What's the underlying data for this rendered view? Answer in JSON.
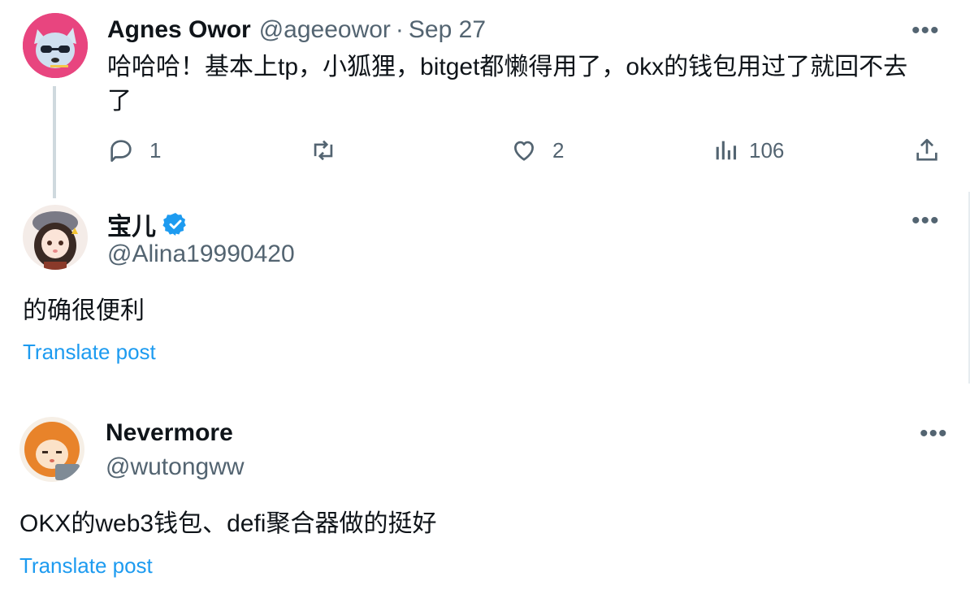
{
  "tweets": [
    {
      "name": "Agnes Owor",
      "handle": "@ageeowor",
      "separator": "·",
      "date": "Sep 27",
      "text": "哈哈哈！基本上tp，小狐狸，bitget都懒得用了，okx的钱包用过了就回不去了",
      "actions": {
        "reply_count": "1",
        "retweet_count": "",
        "like_count": "2",
        "views_count": "106"
      }
    },
    {
      "name": "宝儿",
      "handle": "@Alina19990420",
      "text": "的确很便利",
      "translate": "Translate post",
      "verified_icon": "verified-badge-icon"
    },
    {
      "name": "Nevermore",
      "handle": "@wutongww",
      "text": "OKX的web3钱包、defi聚合器做的挺好",
      "translate": "Translate post"
    }
  ],
  "more_label": "•••",
  "colors": {
    "accent": "#1d9bf0",
    "secondary_text": "#536471",
    "primary_text": "#0f1419",
    "thread_line": "#cfd9de"
  }
}
